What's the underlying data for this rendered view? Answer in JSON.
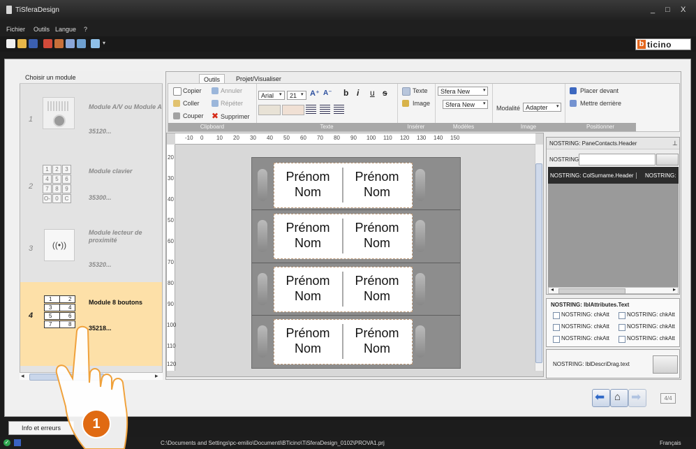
{
  "window": {
    "title": "TiSferaDesign",
    "controls": [
      "_",
      "□",
      "X"
    ]
  },
  "menu": {
    "items": [
      "Fichier",
      "Outils",
      "Langue",
      "?"
    ]
  },
  "brand": {
    "logo_text": "ticino",
    "logo_b": "b"
  },
  "left_panel": {
    "header": "Choisir un module",
    "modules": [
      {
        "number": "1",
        "name": "Module A/V ou Module A",
        "code": "35120..."
      },
      {
        "number": "2",
        "name": "Module clavier",
        "code": "35300...",
        "keys": [
          "1",
          "2",
          "3",
          "4",
          "5",
          "6",
          "7",
          "8",
          "9",
          "O-",
          "0",
          "C"
        ]
      },
      {
        "number": "3",
        "name": "Module lecteur de proximité",
        "code": "35320..."
      },
      {
        "number": "4",
        "name": "Module 8 boutons",
        "code": "35218...",
        "buttons": [
          "1",
          "2",
          "3",
          "4",
          "5",
          "6",
          "7",
          "8"
        ]
      }
    ]
  },
  "tabs": [
    "Outils",
    "Projet/Visualiser"
  ],
  "ribbon": {
    "clipboard": {
      "label": "Clipboard",
      "copier": "Copier",
      "annuler": "Annuler",
      "coller": "Coller",
      "repeter": "Répéter",
      "couper": "Couper",
      "supprimer": "Supprimer"
    },
    "texte": {
      "label": "Texte",
      "font": "Arial",
      "size": "21",
      "bold": "b",
      "italic": "i",
      "underline": "u",
      "strike": "s"
    },
    "inserer": {
      "label": "Insérer",
      "texte": "Texte",
      "image": "Image"
    },
    "modeles": {
      "label": "Modèles",
      "select1": "Sfera New",
      "select2": "Sfera New"
    },
    "image": {
      "label": "Image",
      "modalite_label": "Modalité",
      "modalite_value": "Adapter"
    },
    "positionner": {
      "label": "Positionner",
      "devant": "Placer devant",
      "derriere": "Mettre derrière"
    }
  },
  "ruler": {
    "top": [
      "-10",
      "0",
      "10",
      "20",
      "30",
      "40",
      "50",
      "60",
      "70",
      "80",
      "90",
      "100",
      "110",
      "120",
      "130",
      "140",
      "150"
    ],
    "left": [
      "20",
      "30",
      "40",
      "50",
      "60",
      "70",
      "80",
      "90",
      "100",
      "110",
      "120"
    ]
  },
  "panel": {
    "rows": [
      {
        "left": [
          "Prénom",
          "Nom"
        ],
        "right": [
          "Prénom",
          "Nom"
        ]
      },
      {
        "left": [
          "Prénom",
          "Nom"
        ],
        "right": [
          "Prénom",
          "Nom"
        ]
      },
      {
        "left": [
          "Prénom",
          "Nom"
        ],
        "right": [
          "Prénom",
          "Nom"
        ]
      },
      {
        "left": [
          "Prénom",
          "Nom"
        ],
        "right": [
          "Prénom",
          "Nom"
        ]
      }
    ]
  },
  "contacts": {
    "header": "NOSTRING: PaneContacts.Header",
    "pin": "ꟼ",
    "filter_label": "NOSTRING:",
    "columns": [
      "NOSTRING: ColSurname.Header",
      "NOSTRING: C"
    ]
  },
  "attributes": {
    "title": "NOSTRING: lblAttributes.Text",
    "checkboxes": [
      "NOSTRING: chkAtt",
      "NOSTRING: chkAtt",
      "NOSTRING: chkAtt",
      "NOSTRING: chkAtt",
      "NOSTRING: chkAtt",
      "NOSTRING: chkAtt"
    ]
  },
  "drag": {
    "label": "NOSTRING: lblDescriDrag.text"
  },
  "navigation": {
    "page": "4/4"
  },
  "footer": {
    "info_tab": "Info et erreurs",
    "path": "C:\\Documents and Settings\\pc-emilio\\Documenti\\BTicino\\TiSferaDesign_0102\\PROVA1.prj",
    "language": "Français"
  },
  "annotation": {
    "step": "1"
  },
  "colors": {
    "selected_module_bg": "#fde0a8",
    "step_badge": "#e06a12",
    "accent": "#e3671e"
  }
}
